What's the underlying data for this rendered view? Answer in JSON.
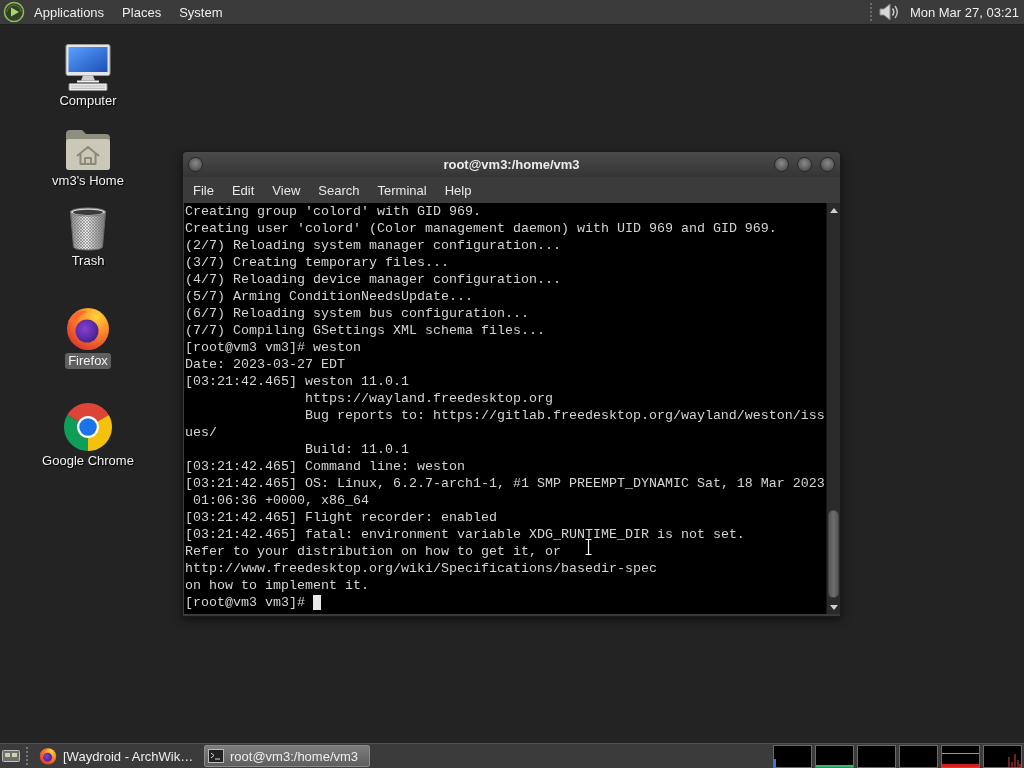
{
  "top_panel": {
    "menus": [
      "Applications",
      "Places",
      "System"
    ],
    "clock": "Mon Mar 27, 03:21"
  },
  "desktop_icons": [
    {
      "kind": "computer",
      "label": "Computer",
      "selected": false
    },
    {
      "kind": "home",
      "label": "vm3's Home",
      "selected": false
    },
    {
      "kind": "trash",
      "label": "Trash",
      "selected": false
    },
    {
      "kind": "firefox",
      "label": "Firefox",
      "selected": true
    },
    {
      "kind": "chrome",
      "label": "Google Chrome",
      "selected": false
    }
  ],
  "terminal_window": {
    "title": "root@vm3:/home/vm3",
    "menus": [
      "File",
      "Edit",
      "View",
      "Search",
      "Terminal",
      "Help"
    ],
    "lines": [
      "Creating group 'colord' with GID 969.",
      "Creating user 'colord' (Color management daemon) with UID 969 and GID 969.",
      "(2/7) Reloading system manager configuration...",
      "(3/7) Creating temporary files...",
      "(4/7) Reloading device manager configuration...",
      "(5/7) Arming ConditionNeedsUpdate...",
      "(6/7) Reloading system bus configuration...",
      "(7/7) Compiling GSettings XML schema files...",
      "[root@vm3 vm3]# weston",
      "Date: 2023-03-27 EDT",
      "[03:21:42.465] weston 11.0.1",
      "               https://wayland.freedesktop.org",
      "               Bug reports to: https://gitlab.freedesktop.org/wayland/weston/iss",
      "ues/",
      "               Build: 11.0.1",
      "[03:21:42.465] Command line: weston",
      "[03:21:42.465] OS: Linux, 6.2.7-arch1-1, #1 SMP PREEMPT_DYNAMIC Sat, 18 Mar 2023",
      " 01:06:36 +0000, x86_64",
      "[03:21:42.465] Flight recorder: enabled",
      "[03:21:42.465] fatal: environment variable XDG_RUNTIME_DIR is not set.",
      "Refer to your distribution on how to get it, or",
      "http://www.freedesktop.org/wiki/Specifications/basedir-spec",
      "on how to implement it."
    ],
    "prompt": "[root@vm3 vm3]#"
  },
  "taskbar": {
    "tasks": [
      {
        "kind": "firefox",
        "label": "[Waydroid - ArchWik…",
        "selected": false
      },
      {
        "kind": "terminal",
        "label": "root@vm3:/home/vm3",
        "selected": true
      }
    ]
  }
}
